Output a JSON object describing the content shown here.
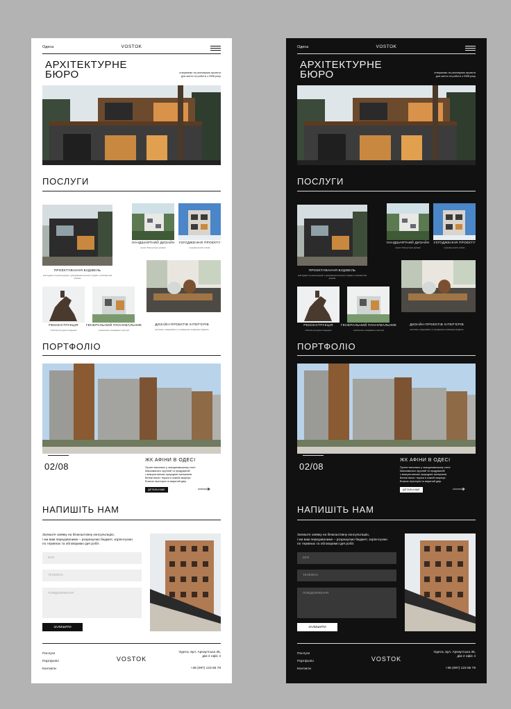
{
  "header": {
    "city": "Одеса",
    "logo": "VOSTOK"
  },
  "hero": {
    "title_line1": "АРХІТЕКТУРНЕ",
    "title_line2": "БЮРО",
    "note_line1": "створюємо та реалізуємо проекти",
    "note_line2": "для життя та роботи з 2008 року"
  },
  "services": {
    "title": "ПОСЛУГИ",
    "items": [
      {
        "label": "ПРОЕКТУВАННЯ БУДІВЕЛЬ",
        "desc": "нові будівлі та реконструкція з урахуванням контексту будівлі, особливостей ділянки"
      },
      {
        "label": "ЛАНДШАФТНИЙ ДИЗАЙН",
        "desc": "проект благоустрою ділянки"
      },
      {
        "label": "УЗГОДЖЕННЯ ПРОЕКТУ",
        "desc": "супровід на всіх етапах"
      },
      {
        "label": "РЕКОНСТРУКЦІЯ",
        "desc": "об'єктів культурної спадщини"
      },
      {
        "label": "ГЕНЕРАЛЬНИЙ ПЛАНУВАЛЬНИК",
        "desc": "комплексне планування території"
      },
      {
        "label": "ДИЗАЙН-ПРОЕКТІВ ІНТЕР'ЄРІВ",
        "desc": "житлових, комерційних та громадських приміщень будівель"
      }
    ]
  },
  "portfolio": {
    "title": "ПОРТФОЛІО",
    "counter": "02/08",
    "project_title": "ЖК АФІНИ В ОДЕСІ",
    "project_desc": [
      "Проект виконано у скандинавському стилі.",
      "Максимально зручний та продуманий",
      "з використанням природних матеріалів.",
      "Великі вікна і тераси в кожній квартирі.",
      "Власна територія та закритий двір."
    ],
    "details_label": "ДЕТАЛЬНІШЕ"
  },
  "contact": {
    "title": "НАПИШІТЬ НАМ",
    "intro": [
      "Залиште заявку на безкоштовну консультацію,",
      "і ми вам передзвонимо – розрахуємо бюджет, зорієнтуємо",
      "по термінах та обговоримо ідеї робіт."
    ],
    "name_placeholder": "ІМ'Я",
    "phone_placeholder": "ТЕЛЕФОН",
    "message_placeholder": "ПОВІДОМЛЕННЯ",
    "send_label": "ЗАЛИШИТИ"
  },
  "footer": {
    "links": [
      "Послуги",
      "Портфоліо",
      "Контакти"
    ],
    "logo": "VOSTOK",
    "address_line1": "Одеса, вул. Арнаутська 35,",
    "address_line2": "дім 2 офіс 4",
    "phone": "+38 (097) 123 56 78"
  },
  "colors": {
    "light_bg": "#ffffff",
    "dark_bg": "#111111",
    "canvas_bg": "#b3b3b3",
    "accent_wood": "#8a5a32"
  }
}
